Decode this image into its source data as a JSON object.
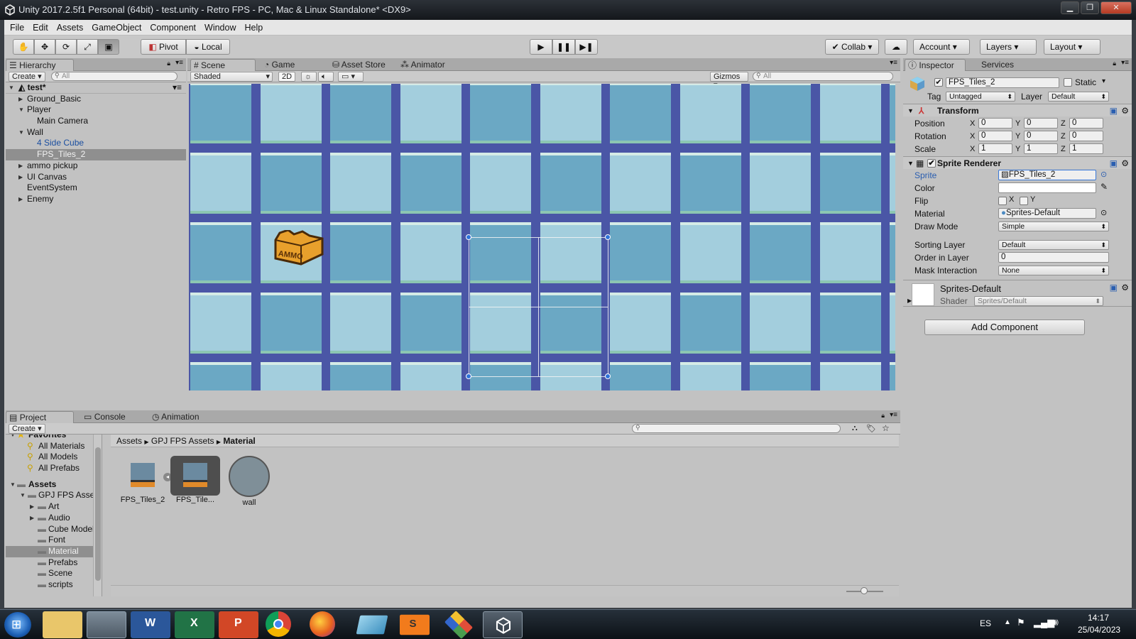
{
  "window": {
    "title": "Unity 2017.2.5f1 Personal (64bit) - test.unity - Retro FPS - PC, Mac & Linux Standalone* <DX9>"
  },
  "menu": [
    "File",
    "Edit",
    "Assets",
    "GameObject",
    "Component",
    "Window",
    "Help"
  ],
  "toolbar": {
    "pivot": "Pivot",
    "local": "Local",
    "collab": "Collab",
    "account": "Account",
    "layers": "Layers",
    "layout": "Layout"
  },
  "hierarchy": {
    "tab": "Hierarchy",
    "create": "Create",
    "search_placeholder": "All",
    "scene": "test*",
    "items": [
      {
        "label": "Ground_Basic",
        "indent": 1,
        "arrow": "▶",
        "style": ""
      },
      {
        "label": "Player",
        "indent": 1,
        "arrow": "▼",
        "style": ""
      },
      {
        "label": "Main Camera",
        "indent": 2,
        "arrow": "",
        "style": ""
      },
      {
        "label": "Wall",
        "indent": 1,
        "arrow": "▼",
        "style": ""
      },
      {
        "label": "4 Side Cube",
        "indent": 2,
        "arrow": "",
        "style": "blue"
      },
      {
        "label": "FPS_Tiles_2",
        "indent": 2,
        "arrow": "",
        "style": "white sel"
      },
      {
        "label": "ammo pickup",
        "indent": 1,
        "arrow": "▶",
        "style": ""
      },
      {
        "label": "UI Canvas",
        "indent": 1,
        "arrow": "▶",
        "style": ""
      },
      {
        "label": "EventSystem",
        "indent": 1,
        "arrow": "",
        "style": ""
      },
      {
        "label": "Enemy",
        "indent": 1,
        "arrow": "▶",
        "style": ""
      }
    ]
  },
  "scene_tabs": {
    "scene": "Scene",
    "game": "Game",
    "asset_store": "Asset Store",
    "animator": "Animator"
  },
  "scene_bar": {
    "shading": "Shaded",
    "mode2d": "2D",
    "gizmos": "Gizmos",
    "search_placeholder": "All"
  },
  "ammo_label": "AMMO",
  "inspector": {
    "tab": "Inspector",
    "services": "Services",
    "name": "FPS_Tiles_2",
    "static": "Static",
    "tag_label": "Tag",
    "tag": "Untagged",
    "layer_label": "Layer",
    "layer": "Default",
    "transform": {
      "title": "Transform",
      "rows": [
        {
          "label": "Position",
          "x": "0",
          "y": "0",
          "z": "0"
        },
        {
          "label": "Rotation",
          "x": "0",
          "y": "0",
          "z": "0"
        },
        {
          "label": "Scale",
          "x": "1",
          "y": "1",
          "z": "1"
        }
      ]
    },
    "sprite_renderer": {
      "title": "Sprite Renderer",
      "sprite_label": "Sprite",
      "sprite": "FPS_Tiles_2",
      "color_label": "Color",
      "flip_label": "Flip",
      "flip_x": "X",
      "flip_y": "Y",
      "material_label": "Material",
      "material": "Sprites-Default",
      "drawmode_label": "Draw Mode",
      "drawmode": "Simple",
      "sorting_label": "Sorting Layer",
      "sorting": "Default",
      "order_label": "Order in Layer",
      "order": "0",
      "mask_label": "Mask Interaction",
      "mask": "None"
    },
    "material": {
      "name": "Sprites-Default",
      "shader_label": "Shader",
      "shader": "Sprites/Default"
    },
    "add_component": "Add Component"
  },
  "project": {
    "tabs": {
      "project": "Project",
      "console": "Console",
      "animation": "Animation"
    },
    "create": "Create",
    "favorites": {
      "title": "Favorites",
      "items": [
        "All Materials",
        "All Models",
        "All Prefabs"
      ]
    },
    "assets_title": "Assets",
    "tree": [
      {
        "label": "GPJ FPS Assets",
        "indent": 1,
        "arrow": "▼",
        "sel": false
      },
      {
        "label": "Art",
        "indent": 2,
        "arrow": "▶",
        "sel": false
      },
      {
        "label": "Audio",
        "indent": 2,
        "arrow": "▶",
        "sel": false
      },
      {
        "label": "Cube Model",
        "indent": 2,
        "arrow": "",
        "sel": false
      },
      {
        "label": "Font",
        "indent": 2,
        "arrow": "",
        "sel": false
      },
      {
        "label": "Material",
        "indent": 2,
        "arrow": "",
        "sel": true
      },
      {
        "label": "Prefabs",
        "indent": 2,
        "arrow": "",
        "sel": false
      },
      {
        "label": "Scene",
        "indent": 2,
        "arrow": "",
        "sel": false
      },
      {
        "label": "scripts",
        "indent": 2,
        "arrow": "",
        "sel": false
      }
    ],
    "breadcrumb": [
      "Assets",
      "GPJ FPS Assets",
      "Material"
    ],
    "assets": [
      "FPS_Tiles_2",
      "FPS_Tile...",
      "wall"
    ]
  },
  "taskbar": {
    "lang": "ES",
    "time": "14:17",
    "date": "25/04/2023"
  },
  "colors": {
    "tile_dark": "#6ba8c4",
    "tile_light": "#a3cedd",
    "grid": "#4a54a8",
    "selection": "#2f72d9"
  }
}
